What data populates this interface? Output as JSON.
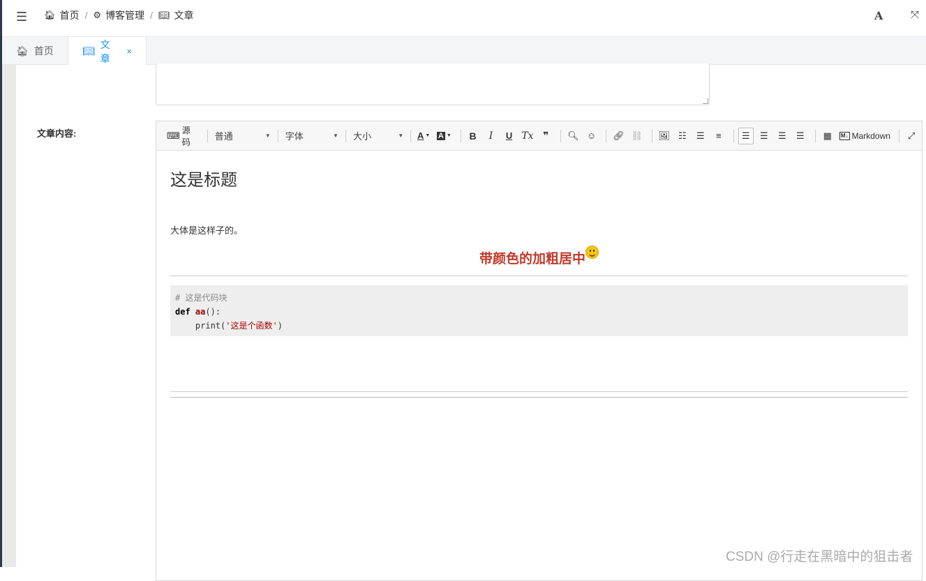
{
  "navbar": {
    "menu_icon": "hamburger-icon",
    "breadcrumb": [
      {
        "icon": "home-icon",
        "label": "首页"
      },
      {
        "icon": "gear-icon",
        "label": "博客管理"
      },
      {
        "icon": "book-icon",
        "label": "文章"
      }
    ],
    "font_size_label": "A",
    "fullscreen_icon": "fullscreen-icon"
  },
  "tabs": [
    {
      "icon": "home-icon",
      "label": "首页",
      "active": false
    },
    {
      "icon": "book-icon",
      "label": "文章",
      "active": true,
      "close": "×"
    }
  ],
  "form": {
    "content_label": "文章内容:"
  },
  "toolbar": {
    "source_label": "源码",
    "paragraph_select": "普通",
    "font_select": "字体",
    "size_select": "大小",
    "bold": "B",
    "italic": "I",
    "underline": "U",
    "clear_format": "Tx",
    "quote": "❞",
    "markdown_label": "Markdown",
    "markdown_badge": "M↓"
  },
  "document": {
    "heading": "这是标题",
    "paragraph": "大体是这样子的。",
    "centered_text": "带颜色的加粗居中",
    "code": {
      "comment": "# 这是代码块",
      "line2_kw": "def",
      "line2_fn": "aa",
      "line2_rest": "():",
      "line3_pre": "    print(",
      "line3_str": "'这是个函数'",
      "line3_post": ")"
    }
  },
  "watermark": "CSDN @行走在黑暗中的狙击者",
  "colors": {
    "accent": "#1890ff",
    "highlight_text": "#c0392b",
    "sidebar_dark": "#2d3a4b"
  }
}
